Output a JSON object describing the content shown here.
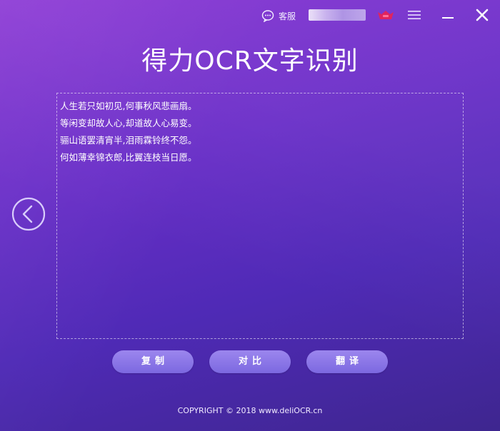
{
  "header": {
    "service_label": "客服",
    "icons": {
      "service": "chat-bubble-icon",
      "vip": "vip-crown-icon",
      "menu": "hamburger-menu-icon",
      "minimize": "minimize-icon",
      "close": "close-icon"
    }
  },
  "app": {
    "title": "得力OCR文字识别"
  },
  "result": {
    "lines": [
      "人生若只如初见,何事秋风悲画扇。",
      "等闲变却故人心,却道故人心易变。",
      "骊山语罢清宵半,泪雨霖铃终不怨。",
      "何如薄幸锦衣郎,比翼连枝当日愿。"
    ]
  },
  "nav": {
    "back_icon": "chevron-left-circle-icon"
  },
  "actions": {
    "copy_label": "复制",
    "compare_label": "对比",
    "translate_label": "翻译"
  },
  "footer": {
    "copyright": "COPYRIGHT © 2018  www.deliOCR.cn"
  },
  "colors": {
    "accent_vip": "#e0245e",
    "button": "#8b76e8",
    "background_top": "#8a35d4",
    "background_bottom": "#3e268f"
  }
}
